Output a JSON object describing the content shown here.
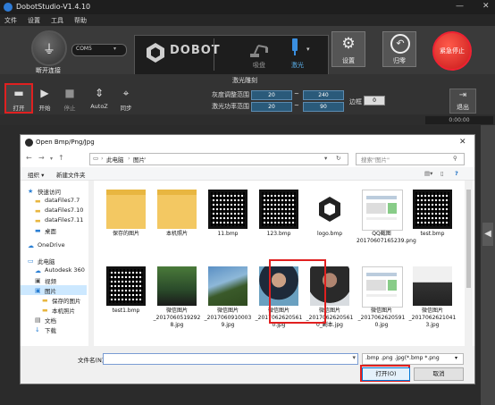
{
  "window": {
    "title": "DobotStudio-V1.4.10"
  },
  "menu": [
    "文件",
    "设置",
    "工具",
    "帮助"
  ],
  "topbar": {
    "connect_label": "断开连接",
    "port_value": "COM5",
    "brand_text": "DOBOT",
    "arm_label": "吸盘",
    "laser_label": "激光",
    "settings_label": "设置",
    "home_label": "归零",
    "stop_label": "紧急停止"
  },
  "toolbar": {
    "mode_title": "激光雕刻",
    "buttons": [
      {
        "label": "打开",
        "icon": "folder-icon"
      },
      {
        "label": "开始",
        "icon": "play-icon"
      },
      {
        "label": "停止",
        "icon": "stop-icon"
      },
      {
        "label": "AutoZ",
        "icon": "autoz-icon"
      },
      {
        "label": "同步",
        "icon": "crosshair-icon"
      }
    ],
    "gray_range_label": "灰度调整范围",
    "gray_min": "20",
    "gray_max": "240",
    "power_range_label": "激光功率范围",
    "power_min": "20",
    "power_max": "90",
    "tilde": "~",
    "edge_label": "边框",
    "edge_value": "0",
    "exit_label": "退出",
    "time_display": "0:00:00"
  },
  "dialog": {
    "title": "Open Bmp/Png/Jpg",
    "address": [
      "此电脑",
      "图片"
    ],
    "search_placeholder": "搜索\"图片\"",
    "organize_label": "组织 ▾",
    "new_folder_label": "新建文件夹",
    "nav_items": [
      {
        "label": "快速访问",
        "icon": "star-icon",
        "indent": 0
      },
      {
        "label": "dataFiles7.7",
        "icon": "folder-icon",
        "indent": 1
      },
      {
        "label": "dataFiles7.10",
        "icon": "folder-icon",
        "indent": 1
      },
      {
        "label": "dataFiles7.11",
        "icon": "folder-icon",
        "indent": 1
      },
      {
        "label": "桌面",
        "icon": "desktop-icon",
        "indent": 1
      },
      {
        "label": "OneDrive",
        "icon": "cloud-icon",
        "indent": 0
      },
      {
        "label": "此电脑",
        "icon": "computer-icon",
        "indent": 0
      },
      {
        "label": "Autodesk 360",
        "icon": "cloud-icon",
        "indent": 1
      },
      {
        "label": "视频",
        "icon": "video-icon",
        "indent": 1
      },
      {
        "label": "图片",
        "icon": "picture-icon",
        "indent": 1
      },
      {
        "label": "保存的图片",
        "icon": "folder-icon",
        "indent": 2
      },
      {
        "label": "本机照片",
        "icon": "folder-icon",
        "indent": 2
      },
      {
        "label": "文档",
        "icon": "document-icon",
        "indent": 1
      },
      {
        "label": "下载",
        "icon": "download-icon",
        "indent": 1
      }
    ],
    "files": [
      {
        "name": "保存的图片",
        "kind": "folder"
      },
      {
        "name": "本机照片",
        "kind": "folder"
      },
      {
        "name": "11.bmp",
        "kind": "qr"
      },
      {
        "name": "123.bmp",
        "kind": "qr"
      },
      {
        "name": "logo.bmp",
        "kind": "logo"
      },
      {
        "name": "QQ截图20170607165239.png",
        "kind": "doc"
      },
      {
        "name": "test.bmp",
        "kind": "qr"
      },
      {
        "name": "test1.bmp",
        "kind": "qr"
      },
      {
        "name": "微信图片_2017060519292 8.jpg",
        "kind": "photo2"
      },
      {
        "name": "微信图片_2017060910003 9.jpg",
        "kind": "photo1"
      },
      {
        "name": "微信图片_2017062620561 0.jpg",
        "kind": "photo3"
      },
      {
        "name": "微信图片_2017062620561 0_副本.jpg",
        "kind": "photo4"
      },
      {
        "name": "微信图片_2017062620591 0.jpg",
        "kind": "doc"
      },
      {
        "name": "微信图片_2017062621041 3.jpg",
        "kind": "machine"
      }
    ],
    "filename_label": "文件名(N):",
    "filename_value": "",
    "filetype_value": ".bmp .png .jpg(*.bmp *.png",
    "open_button": "打开(O)",
    "cancel_button": "取消"
  }
}
